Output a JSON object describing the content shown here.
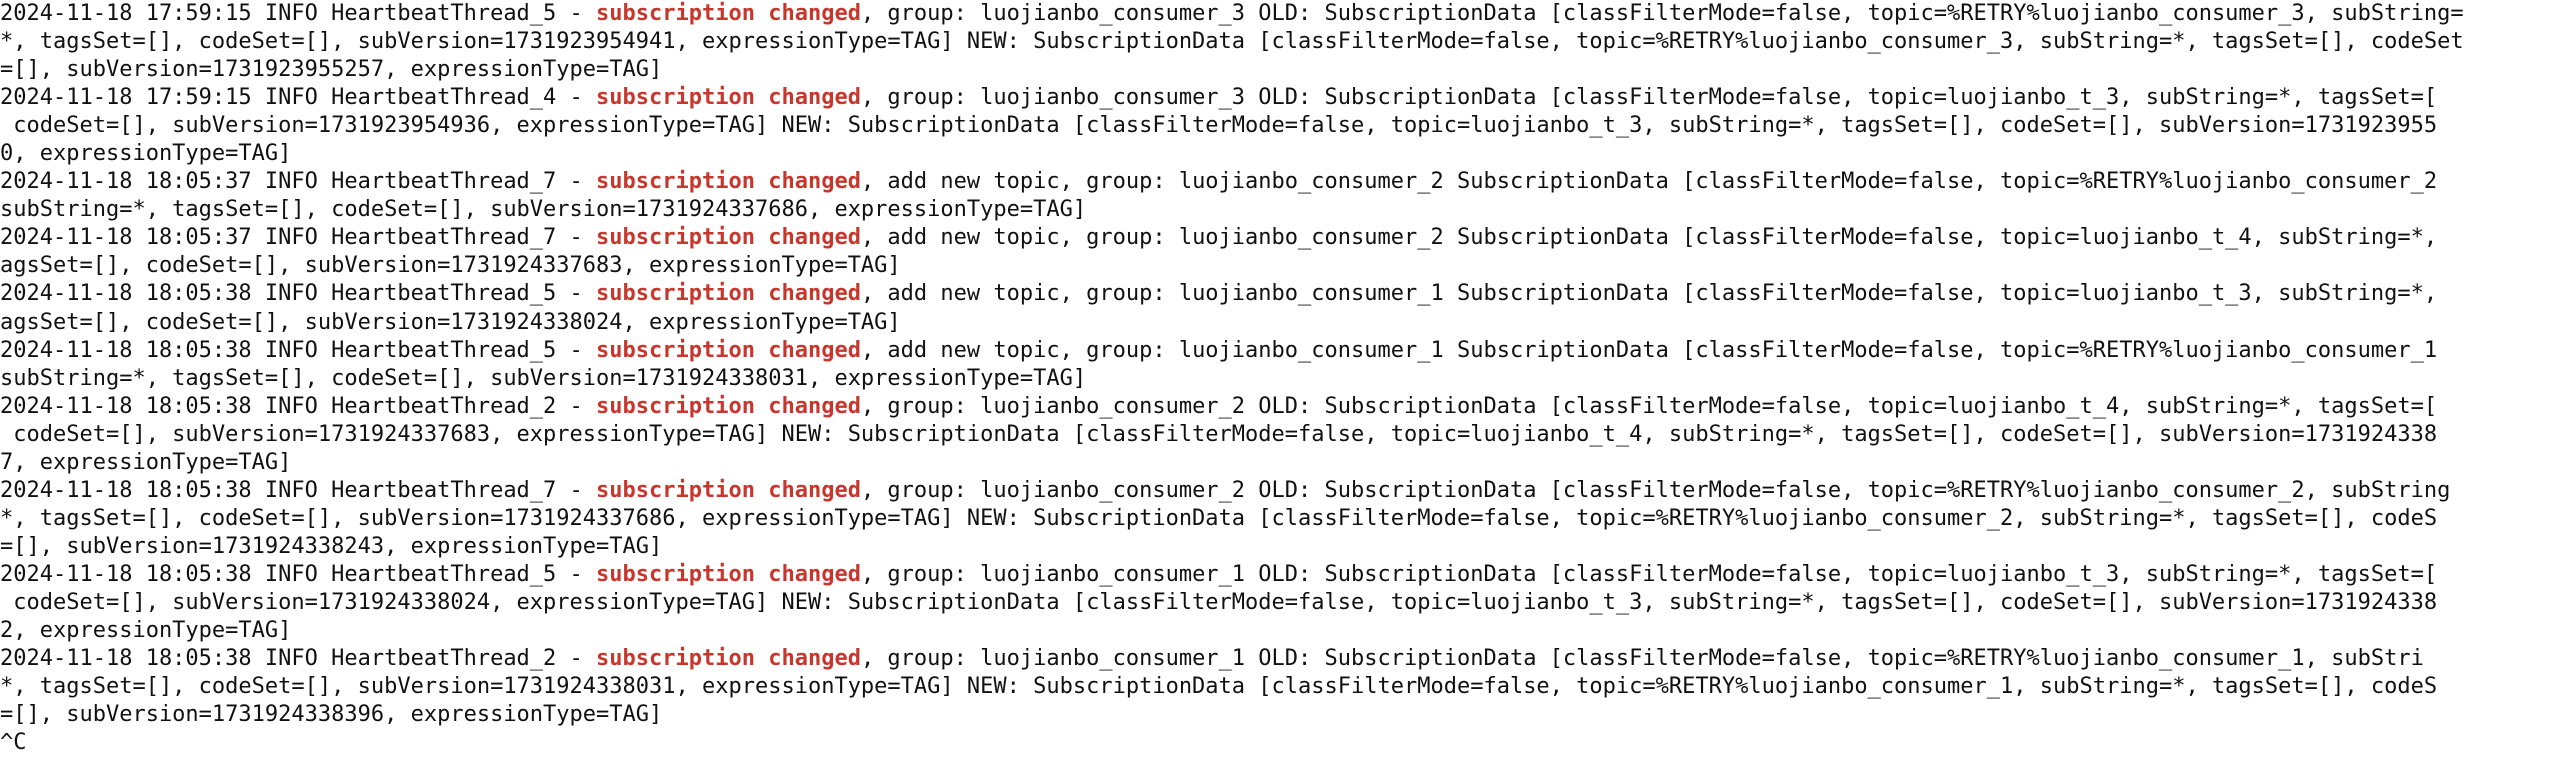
{
  "theme": {
    "background": "#ffffff",
    "text_color": "#111111",
    "highlight_color": "#c8372d"
  },
  "terminal": {
    "lines": [
      {
        "pre": "2024-11-18 17:59:15 INFO HeartbeatThread_5 - ",
        "hl": "subscription changed",
        "post": ", group: luojianbo_consumer_3 OLD: SubscriptionData [classFilterMode=false, topic=%RETRY%luojianbo_consumer_3, subString="
      },
      {
        "pre": "*, tagsSet=[], codeSet=[], subVersion=1731923954941, expressionType=TAG] NEW: SubscriptionData [classFilterMode=false, topic=%RETRY%luojianbo_consumer_3, subString=*, tagsSet=[], codeSet"
      },
      {
        "pre": "=[], subVersion=1731923955257, expressionType=TAG]"
      },
      {
        "pre": "2024-11-18 17:59:15 INFO HeartbeatThread_4 - ",
        "hl": "subscription changed",
        "post": ", group: luojianbo_consumer_3 OLD: SubscriptionData [classFilterMode=false, topic=luojianbo_t_3, subString=*, tagsSet=["
      },
      {
        "pre": " codeSet=[], subVersion=1731923954936, expressionType=TAG] NEW: SubscriptionData [classFilterMode=false, topic=luojianbo_t_3, subString=*, tagsSet=[], codeSet=[], subVersion=1731923955"
      },
      {
        "pre": "0, expressionType=TAG]"
      },
      {
        "pre": "2024-11-18 18:05:37 INFO HeartbeatThread_7 - ",
        "hl": "subscription changed",
        "post": ", add new topic, group: luojianbo_consumer_2 SubscriptionData [classFilterMode=false, topic=%RETRY%luojianbo_consumer_2"
      },
      {
        "pre": "subString=*, tagsSet=[], codeSet=[], subVersion=1731924337686, expressionType=TAG]"
      },
      {
        "pre": "2024-11-18 18:05:37 INFO HeartbeatThread_7 - ",
        "hl": "subscription changed",
        "post": ", add new topic, group: luojianbo_consumer_2 SubscriptionData [classFilterMode=false, topic=luojianbo_t_4, subString=*,"
      },
      {
        "pre": "agsSet=[], codeSet=[], subVersion=1731924337683, expressionType=TAG]"
      },
      {
        "pre": "2024-11-18 18:05:38 INFO HeartbeatThread_5 - ",
        "hl": "subscription changed",
        "post": ", add new topic, group: luojianbo_consumer_1 SubscriptionData [classFilterMode=false, topic=luojianbo_t_3, subString=*,"
      },
      {
        "pre": "agsSet=[], codeSet=[], subVersion=1731924338024, expressionType=TAG]"
      },
      {
        "pre": "2024-11-18 18:05:38 INFO HeartbeatThread_5 - ",
        "hl": "subscription changed",
        "post": ", add new topic, group: luojianbo_consumer_1 SubscriptionData [classFilterMode=false, topic=%RETRY%luojianbo_consumer_1"
      },
      {
        "pre": "subString=*, tagsSet=[], codeSet=[], subVersion=1731924338031, expressionType=TAG]"
      },
      {
        "pre": "2024-11-18 18:05:38 INFO HeartbeatThread_2 - ",
        "hl": "subscription changed",
        "post": ", group: luojianbo_consumer_2 OLD: SubscriptionData [classFilterMode=false, topic=luojianbo_t_4, subString=*, tagsSet=["
      },
      {
        "pre": " codeSet=[], subVersion=1731924337683, expressionType=TAG] NEW: SubscriptionData [classFilterMode=false, topic=luojianbo_t_4, subString=*, tagsSet=[], codeSet=[], subVersion=1731924338"
      },
      {
        "pre": "7, expressionType=TAG]"
      },
      {
        "pre": "2024-11-18 18:05:38 INFO HeartbeatThread_7 - ",
        "hl": "subscription changed",
        "post": ", group: luojianbo_consumer_2 OLD: SubscriptionData [classFilterMode=false, topic=%RETRY%luojianbo_consumer_2, subString"
      },
      {
        "pre": "*, tagsSet=[], codeSet=[], subVersion=1731924337686, expressionType=TAG] NEW: SubscriptionData [classFilterMode=false, topic=%RETRY%luojianbo_consumer_2, subString=*, tagsSet=[], codeS"
      },
      {
        "pre": "=[], subVersion=1731924338243, expressionType=TAG]"
      },
      {
        "pre": "2024-11-18 18:05:38 INFO HeartbeatThread_5 - ",
        "hl": "subscription changed",
        "post": ", group: luojianbo_consumer_1 OLD: SubscriptionData [classFilterMode=false, topic=luojianbo_t_3, subString=*, tagsSet=["
      },
      {
        "pre": " codeSet=[], subVersion=1731924338024, expressionType=TAG] NEW: SubscriptionData [classFilterMode=false, topic=luojianbo_t_3, subString=*, tagsSet=[], codeSet=[], subVersion=1731924338"
      },
      {
        "pre": "2, expressionType=TAG]"
      },
      {
        "pre": "2024-11-18 18:05:38 INFO HeartbeatThread_2 - ",
        "hl": "subscription changed",
        "post": ", group: luojianbo_consumer_1 OLD: SubscriptionData [classFilterMode=false, topic=%RETRY%luojianbo_consumer_1, subStri"
      },
      {
        "pre": "*, tagsSet=[], codeSet=[], subVersion=1731924338031, expressionType=TAG] NEW: SubscriptionData [classFilterMode=false, topic=%RETRY%luojianbo_consumer_1, subString=*, tagsSet=[], codeS"
      },
      {
        "pre": "=[], subVersion=1731924338396, expressionType=TAG]"
      }
    ],
    "interrupt_text": "^C"
  }
}
